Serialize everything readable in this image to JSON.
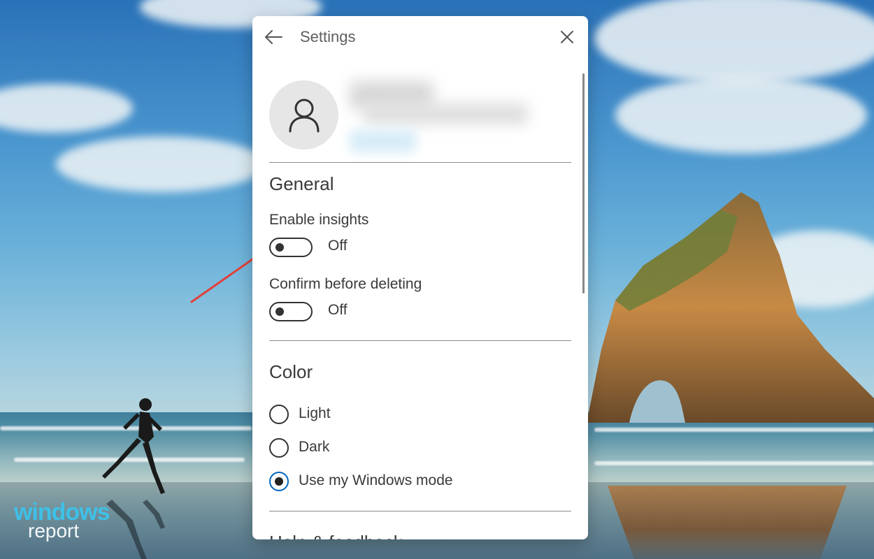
{
  "window": {
    "title": "Settings"
  },
  "general": {
    "heading": "General",
    "enable_insights": {
      "label": "Enable insights",
      "state": "Off"
    },
    "confirm_delete": {
      "label": "Confirm before deleting",
      "state": "Off"
    }
  },
  "color": {
    "heading": "Color",
    "options": [
      {
        "label": "Light",
        "selected": false
      },
      {
        "label": "Dark",
        "selected": false
      },
      {
        "label": "Use my Windows mode",
        "selected": true
      }
    ]
  },
  "next_section": {
    "heading": "Help & feedback"
  },
  "watermark": {
    "line1": "windows",
    "line2": "report"
  },
  "colors": {
    "accent": "#0067c0",
    "annotation_arrow": "#e0403a"
  },
  "icons": {
    "back": "back-arrow-icon",
    "close": "close-icon",
    "avatar": "person-icon"
  }
}
